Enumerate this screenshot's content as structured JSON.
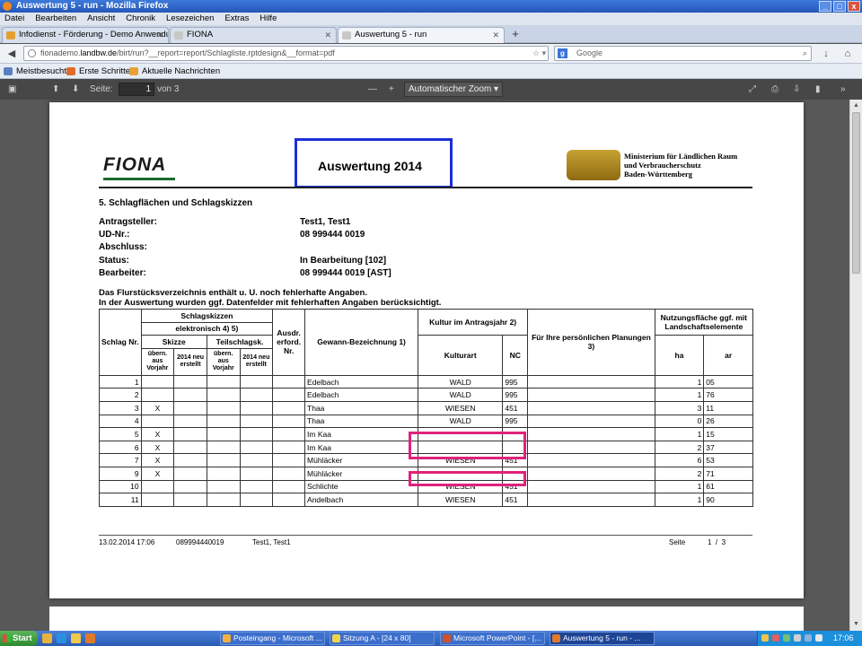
{
  "window": {
    "title": "Auswertung 5 - run - Mozilla Firefox",
    "controls": [
      "_",
      "□",
      "x"
    ]
  },
  "menu": [
    "Datei",
    "Bearbeiten",
    "Ansicht",
    "Chronik",
    "Lesezeichen",
    "Extras",
    "Hilfe"
  ],
  "tabs": [
    {
      "label": "Infodienst - Förderung - Demo Anwendung",
      "active": false
    },
    {
      "label": "FIONA",
      "active": false
    },
    {
      "label": "Auswertung 5 - run",
      "active": true
    }
  ],
  "nav": {
    "url_prefix": "fionademo.",
    "url_domain": "landbw.de",
    "url_rest": "/birt/run?__report=report/Schlagliste.rptdesign&__format=pdf",
    "search_placeholder": "Google"
  },
  "bookmarks": [
    "Meistbesucht",
    "Erste Schritte",
    "Aktuelle Nachrichten"
  ],
  "pdf_toolbar": {
    "page_label": "Seite:",
    "page_value": "1",
    "page_total": "von 3",
    "zoom": "Automatischer Zoom",
    "zoom_minus": "—",
    "zoom_plus": "+"
  },
  "doc": {
    "logo": "FIONA",
    "heading": "Auswertung 2014",
    "ministry": [
      "Ministerium für Ländlichen Raum",
      "und Verbraucherschutz",
      "Baden-Württemberg"
    ],
    "section": "5. Schlagflächen und Schlagskizzen",
    "fields": [
      {
        "label": "Antragsteller:",
        "value": "Test1, Test1"
      },
      {
        "label": "UD-Nr.:",
        "value": "08 999444 0019"
      },
      {
        "label": "Abschluss:",
        "value": ""
      },
      {
        "label": "Status:",
        "value": "In Bearbeitung [102]"
      },
      {
        "label": "Bearbeiter:",
        "value": "08 999444 0019 [AST]"
      }
    ],
    "notes": [
      "Das Flurstücksverzeichnis enthält u. U. noch fehlerhafte Angaben.",
      "In der Auswertung wurden ggf. Datenfelder mit fehlerhaften Angaben berücksichtigt."
    ],
    "table_headers": {
      "schlag": "Schlag Nr.",
      "skizzen": "Schlagskizzen",
      "elektronisch": "elektronisch 4) 5)",
      "skizze": "Skizze",
      "teilschlag": "Teilschlagsk.",
      "uebern": "übern. aus Vorjahr",
      "neu": "2014 neu erstellt",
      "ausdr": "Ausdr. erford. Nr.",
      "gewann": "Gewann-Bezeichnung 1)",
      "kultur": "Kultur im Antragsjahr 2)",
      "kulturart": "Kulturart",
      "nc": "NC",
      "planungen": "Für Ihre persönlichen Planungen 3)",
      "nutzung": "Nutzungsfläche ggf. mit Landschaftselemente",
      "ha": "ha",
      "ar": "ar"
    },
    "rows": [
      {
        "nr": "1",
        "skizze": "",
        "gewann": "Edelbach",
        "kulturart": "WALD",
        "nc": "995",
        "ha": "1",
        "ar": "05"
      },
      {
        "nr": "2",
        "skizze": "",
        "gewann": "Edelbach",
        "kulturart": "WALD",
        "nc": "995",
        "ha": "1",
        "ar": "76"
      },
      {
        "nr": "3",
        "skizze": "X",
        "gewann": "Thaa",
        "kulturart": "WIESEN",
        "nc": "451",
        "ha": "3",
        "ar": "11"
      },
      {
        "nr": "4",
        "skizze": "",
        "gewann": "Thaa",
        "kulturart": "WALD",
        "nc": "995",
        "ha": "0",
        "ar": "26"
      },
      {
        "nr": "5",
        "skizze": "X",
        "gewann": "Im Kaa",
        "kulturart": "",
        "nc": "",
        "ha": "1",
        "ar": "15"
      },
      {
        "nr": "6",
        "skizze": "X",
        "gewann": "Im Kaa",
        "kulturart": "",
        "nc": "",
        "ha": "2",
        "ar": "37"
      },
      {
        "nr": "7",
        "skizze": "X",
        "gewann": "Mühläcker",
        "kulturart": "WIESEN",
        "nc": "451",
        "ha": "6",
        "ar": "53"
      },
      {
        "nr": "9",
        "skizze": "X",
        "gewann": "Mühläcker",
        "kulturart": "",
        "nc": "",
        "ha": "2",
        "ar": "71"
      },
      {
        "nr": "10",
        "skizze": "",
        "gewann": "Schlichte",
        "kulturart": "WIESEN",
        "nc": "451",
        "ha": "1",
        "ar": "61"
      },
      {
        "nr": "11",
        "skizze": "",
        "gewann": "Andelbach",
        "kulturart": "WIESEN",
        "nc": "451",
        "ha": "1",
        "ar": "90"
      }
    ],
    "footer": {
      "date": "13.02.2014 17:06",
      "id": "089994440019",
      "name": "Test1, Test1",
      "page_label": "Seite",
      "page": "1  /  3"
    }
  },
  "taskbar": {
    "start": "Start",
    "tasks": [
      {
        "label": "Posteingang - Microsoft ...",
        "active": false
      },
      {
        "label": "Sitzung A - [24 x 80]",
        "active": false
      },
      {
        "label": "Microsoft PowerPoint - [...",
        "active": false
      },
      {
        "label": "Auswertung 5 - run - ...",
        "active": true
      }
    ],
    "clock": "17:06"
  }
}
